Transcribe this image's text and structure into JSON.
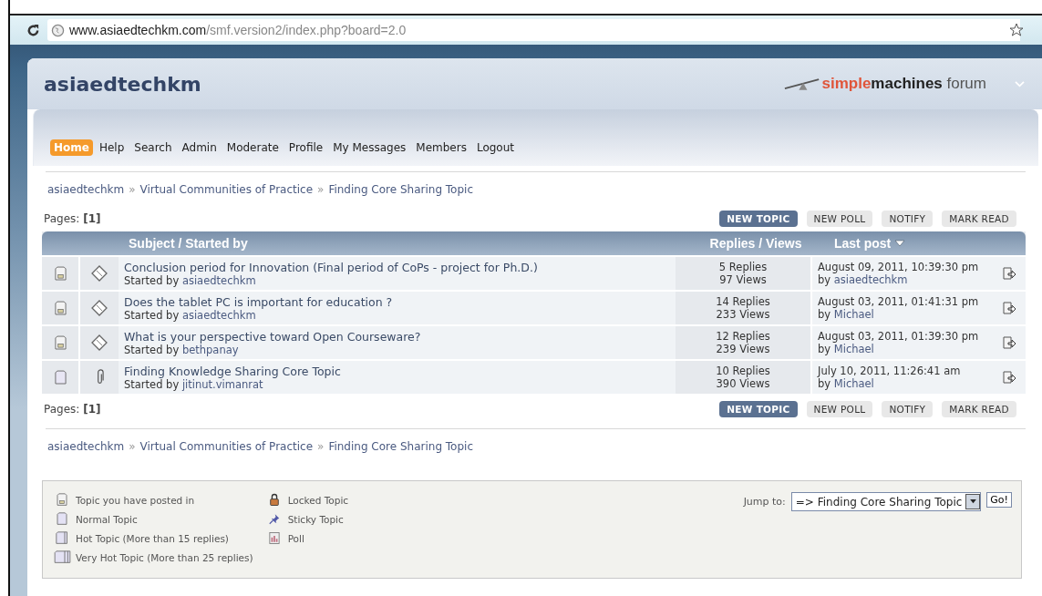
{
  "browser": {
    "url_host": "www.asiaedtechkm.com",
    "url_path": "/smf.version2/index.php?board=2.0"
  },
  "forum": {
    "title": "asiaedtechkm",
    "logo_a": "simple",
    "logo_b": "machines",
    "logo_c": "forum"
  },
  "menu": [
    {
      "label": "Home",
      "selected": true
    },
    {
      "label": "Help",
      "selected": false
    },
    {
      "label": "Search",
      "selected": false
    },
    {
      "label": "Admin",
      "selected": false
    },
    {
      "label": "Moderate",
      "selected": false
    },
    {
      "label": "Profile",
      "selected": false
    },
    {
      "label": "My Messages",
      "selected": false
    },
    {
      "label": "Members",
      "selected": false
    },
    {
      "label": "Logout",
      "selected": false
    }
  ],
  "breadcrumb_top": {
    "separator": "»",
    "items": [
      "asiaedtechkm",
      "Virtual Communities of Practice",
      "Finding Core Sharing Topic"
    ]
  },
  "pages_top": {
    "label": "Pages:",
    "current": "[1]"
  },
  "buttons_top": [
    {
      "label": "NEW TOPIC",
      "kind": "primary"
    },
    {
      "label": "NEW POLL",
      "kind": "plain"
    },
    {
      "label": "NOTIFY",
      "kind": "plain"
    },
    {
      "label": "MARK READ",
      "kind": "plain"
    }
  ],
  "table": {
    "columns": [
      "Subject / Started by",
      "Replies / Views",
      "Last post"
    ],
    "rows": [
      {
        "kind": "posted",
        "subject": "Conclusion period for Innovation (Final period of CoPs - project for Ph.D.)",
        "started_label": "Started by",
        "starter": "asiaedtechkm",
        "replies": "5 Replies",
        "views": "97 Views",
        "last_date": "August 09, 2011, 10:39:30 pm",
        "by_label": "by",
        "last_by": "asiaedtechkm"
      },
      {
        "kind": "posted",
        "subject": "Does the tablet PC is important for education ?",
        "started_label": "Started by",
        "starter": "asiaedtechkm",
        "replies": "14 Replies",
        "views": "233 Views",
        "last_date": "August 03, 2011, 01:41:31 pm",
        "by_label": "by",
        "last_by": "Michael"
      },
      {
        "kind": "posted",
        "subject": "What is your perspective toward Open Courseware?",
        "started_label": "Started by",
        "starter": "bethpanay",
        "replies": "12 Replies",
        "views": "239 Views",
        "last_date": "August 03, 2011, 01:39:30 pm",
        "by_label": "by",
        "last_by": "Michael"
      },
      {
        "kind": "attachment",
        "subject": "Finding Knowledge Sharing Core Topic",
        "started_label": "Started by",
        "starter": "jitinut.vimanrat",
        "replies": "10 Replies",
        "views": "390 Views",
        "last_date": "July 10, 2011, 11:26:41 am",
        "by_label": "by",
        "last_by": "Michael"
      }
    ]
  },
  "pages_bottom": {
    "label": "Pages:",
    "current": "[1]"
  },
  "buttons_bottom": [
    {
      "label": "NEW TOPIC",
      "kind": "primary"
    },
    {
      "label": "NEW POLL",
      "kind": "plain"
    },
    {
      "label": "NOTIFY",
      "kind": "plain"
    },
    {
      "label": "MARK READ",
      "kind": "plain"
    }
  ],
  "breadcrumb_bottom": {
    "separator": "»",
    "items": [
      "asiaedtechkm",
      "Virtual Communities of Practice",
      "Finding Core Sharing Topic"
    ]
  },
  "legend": {
    "column_1": [
      {
        "kind": "posted",
        "label": "Topic you have posted in"
      },
      {
        "kind": "normal",
        "label": "Normal Topic"
      },
      {
        "kind": "hot",
        "label": "Hot Topic (More than 15 replies)"
      },
      {
        "kind": "veryhot",
        "label": "Very Hot Topic (More than 25 replies)"
      }
    ],
    "column_2": [
      {
        "kind": "locked",
        "label": "Locked Topic"
      },
      {
        "kind": "sticky",
        "label": "Sticky Topic"
      },
      {
        "kind": "poll",
        "label": "Poll"
      }
    ]
  },
  "jump": {
    "label": "Jump to:",
    "value": "=> Finding Core Sharing Topic",
    "button": "Go!"
  }
}
